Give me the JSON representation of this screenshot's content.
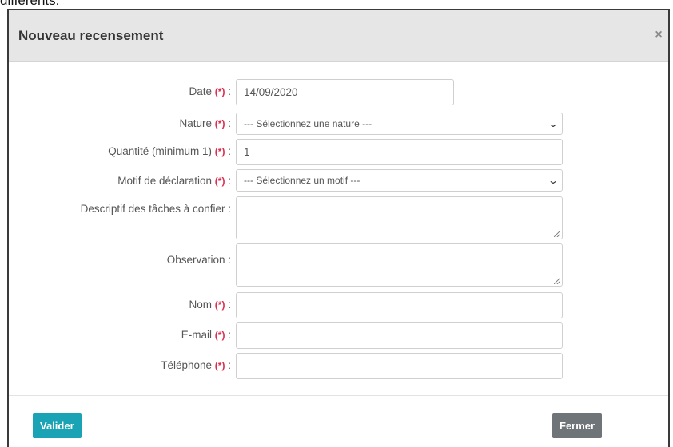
{
  "page_snippet": "différents.",
  "modal": {
    "title": "Nouveau recensement",
    "close_label": "×"
  },
  "required_marker": "(*)",
  "fields": {
    "date": {
      "label": "Date",
      "value": "14/09/2020"
    },
    "nature": {
      "label": "Nature",
      "selected": "--- Sélectionnez une nature ---"
    },
    "quantite": {
      "label": "Quantité (minimum 1)",
      "value": "1"
    },
    "motif": {
      "label": "Motif de déclaration",
      "selected": "--- Sélectionnez un motif ---"
    },
    "descriptif": {
      "label": "Descriptif des tâches à confier :",
      "value": ""
    },
    "observation": {
      "label": "Observation :",
      "value": ""
    },
    "nom": {
      "label": "Nom",
      "value": ""
    },
    "email": {
      "label": "E-mail",
      "value": ""
    },
    "telephone": {
      "label": "Téléphone",
      "value": ""
    }
  },
  "label_colon": ":",
  "buttons": {
    "valider": "Valider",
    "fermer": "Fermer"
  },
  "colors": {
    "primary_button": "#1aa3b4",
    "secondary_button": "#6f7479",
    "required": "#d9304f",
    "header_bg": "#e6e6e6"
  },
  "icons": {
    "close": "close-icon",
    "select_arrow": "chevron-down-icon",
    "resize": "resize-grip-icon"
  }
}
